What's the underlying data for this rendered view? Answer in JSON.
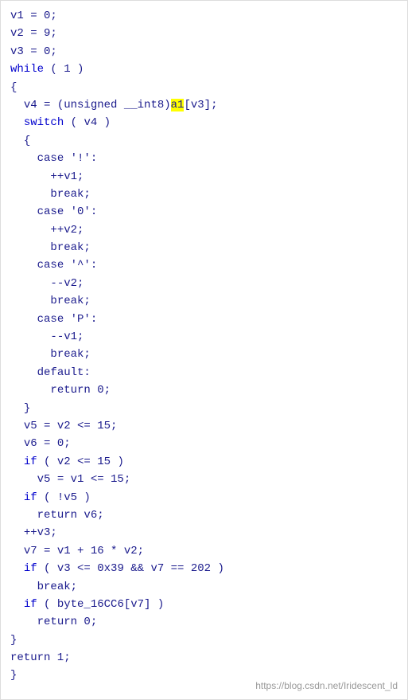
{
  "code": {
    "lines": [
      {
        "id": 1,
        "indent": 0,
        "parts": [
          {
            "text": "v1 = 0;",
            "type": "normal"
          }
        ]
      },
      {
        "id": 2,
        "indent": 0,
        "parts": [
          {
            "text": "v2 = 9;",
            "type": "normal"
          }
        ]
      },
      {
        "id": 3,
        "indent": 0,
        "parts": [
          {
            "text": "v3 = 0;",
            "type": "normal"
          }
        ]
      },
      {
        "id": 4,
        "indent": 0,
        "parts": [
          {
            "text": "while",
            "type": "keyword"
          },
          {
            "text": " ( 1 )",
            "type": "normal"
          }
        ]
      },
      {
        "id": 5,
        "indent": 0,
        "parts": [
          {
            "text": "{",
            "type": "normal"
          }
        ]
      },
      {
        "id": 6,
        "indent": 1,
        "parts": [
          {
            "text": "v4 = (unsigned __int8)",
            "type": "normal"
          },
          {
            "text": "a1",
            "type": "highlight"
          },
          {
            "text": "[v3];",
            "type": "normal"
          }
        ]
      },
      {
        "id": 7,
        "indent": 1,
        "parts": [
          {
            "text": "switch",
            "type": "keyword"
          },
          {
            "text": " ( v4 )",
            "type": "normal"
          }
        ]
      },
      {
        "id": 8,
        "indent": 1,
        "parts": [
          {
            "text": "{",
            "type": "normal"
          }
        ]
      },
      {
        "id": 9,
        "indent": 2,
        "parts": [
          {
            "text": "case '!':",
            "type": "normal"
          }
        ]
      },
      {
        "id": 10,
        "indent": 3,
        "parts": [
          {
            "text": "++v1;",
            "type": "normal"
          }
        ]
      },
      {
        "id": 11,
        "indent": 3,
        "parts": [
          {
            "text": "break;",
            "type": "normal"
          }
        ]
      },
      {
        "id": 12,
        "indent": 2,
        "parts": [
          {
            "text": "case '0':",
            "type": "normal"
          }
        ]
      },
      {
        "id": 13,
        "indent": 3,
        "parts": [
          {
            "text": "++v2;",
            "type": "normal"
          }
        ]
      },
      {
        "id": 14,
        "indent": 3,
        "parts": [
          {
            "text": "break;",
            "type": "normal"
          }
        ]
      },
      {
        "id": 15,
        "indent": 2,
        "parts": [
          {
            "text": "case '^':",
            "type": "normal"
          }
        ]
      },
      {
        "id": 16,
        "indent": 3,
        "parts": [
          {
            "text": "--v2;",
            "type": "normal"
          }
        ]
      },
      {
        "id": 17,
        "indent": 3,
        "parts": [
          {
            "text": "break;",
            "type": "normal"
          }
        ]
      },
      {
        "id": 18,
        "indent": 2,
        "parts": [
          {
            "text": "case 'P':",
            "type": "normal"
          }
        ]
      },
      {
        "id": 19,
        "indent": 3,
        "parts": [
          {
            "text": "--v1;",
            "type": "normal"
          }
        ]
      },
      {
        "id": 20,
        "indent": 3,
        "parts": [
          {
            "text": "break;",
            "type": "normal"
          }
        ]
      },
      {
        "id": 21,
        "indent": 2,
        "parts": [
          {
            "text": "default:",
            "type": "normal"
          }
        ]
      },
      {
        "id": 22,
        "indent": 3,
        "parts": [
          {
            "text": "return 0;",
            "type": "normal"
          }
        ]
      },
      {
        "id": 23,
        "indent": 1,
        "parts": [
          {
            "text": "}",
            "type": "normal"
          }
        ]
      },
      {
        "id": 24,
        "indent": 1,
        "parts": [
          {
            "text": "v5 = v2 <= 15;",
            "type": "normal"
          }
        ]
      },
      {
        "id": 25,
        "indent": 1,
        "parts": [
          {
            "text": "v6 = 0;",
            "type": "normal"
          }
        ]
      },
      {
        "id": 26,
        "indent": 1,
        "parts": [
          {
            "text": "if",
            "type": "keyword"
          },
          {
            "text": " ( v2 <= 15 )",
            "type": "normal"
          }
        ]
      },
      {
        "id": 27,
        "indent": 2,
        "parts": [
          {
            "text": "v5 = v1 <= 15;",
            "type": "normal"
          }
        ]
      },
      {
        "id": 28,
        "indent": 1,
        "parts": [
          {
            "text": "if",
            "type": "keyword"
          },
          {
            "text": " ( !v5 )",
            "type": "normal"
          }
        ]
      },
      {
        "id": 29,
        "indent": 2,
        "parts": [
          {
            "text": "return v6;",
            "type": "normal"
          }
        ]
      },
      {
        "id": 30,
        "indent": 1,
        "parts": [
          {
            "text": "++v3;",
            "type": "normal"
          }
        ]
      },
      {
        "id": 31,
        "indent": 1,
        "parts": [
          {
            "text": "v7 = v1 + 16 * v2;",
            "type": "normal"
          }
        ]
      },
      {
        "id": 32,
        "indent": 1,
        "parts": [
          {
            "text": "if",
            "type": "keyword"
          },
          {
            "text": " ( v3 <= 0x39 && v7 == 202 )",
            "type": "normal"
          }
        ]
      },
      {
        "id": 33,
        "indent": 2,
        "parts": [
          {
            "text": "break;",
            "type": "normal"
          }
        ]
      },
      {
        "id": 34,
        "indent": 1,
        "parts": [
          {
            "text": "if",
            "type": "keyword"
          },
          {
            "text": " ( byte_16CC6[v7] )",
            "type": "normal"
          }
        ]
      },
      {
        "id": 35,
        "indent": 2,
        "parts": [
          {
            "text": "return 0;",
            "type": "normal"
          }
        ]
      },
      {
        "id": 36,
        "indent": 0,
        "parts": [
          {
            "text": "}",
            "type": "normal"
          }
        ]
      },
      {
        "id": 37,
        "indent": 0,
        "parts": [
          {
            "text": "return 1;",
            "type": "normal"
          }
        ]
      },
      {
        "id": 38,
        "indent": 0,
        "parts": [
          {
            "text": "}",
            "type": "normal"
          }
        ]
      }
    ],
    "watermark": "https://blog.csdn.net/Iridescent_ld"
  }
}
